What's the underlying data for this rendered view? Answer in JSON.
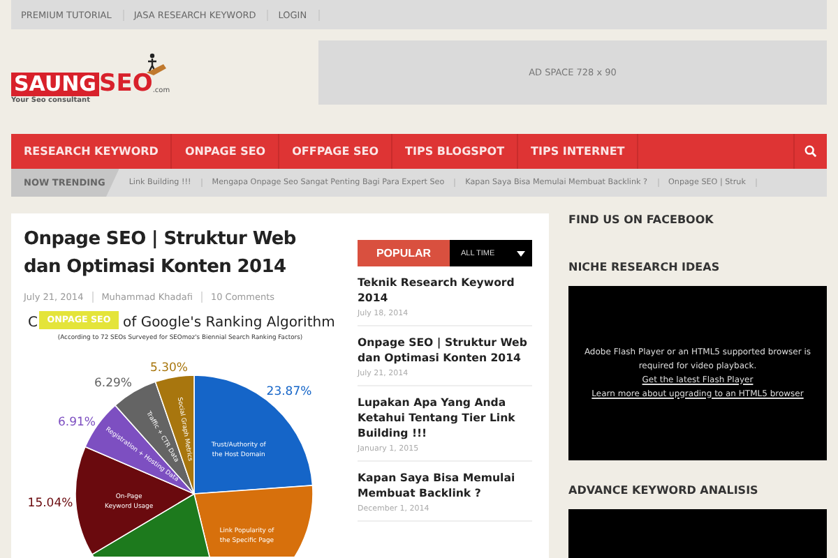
{
  "top_menu": [
    "PREMIUM TUTORIAL",
    "JASA RESEARCH KEYWORD",
    "LOGIN"
  ],
  "logo": {
    "part1": "SAUNG",
    "part2": "SEO",
    "suffix": ".com",
    "tagline": "Your Seo consultant"
  },
  "ad": "AD SPACE 728 x 90",
  "nav": [
    "RESEARCH KEYWORD",
    "ONPAGE SEO",
    "OFFPAGE SEO",
    "TIPS BLOGSPOT",
    "TIPS INTERNET"
  ],
  "trending": {
    "label": "NOW TRENDING",
    "items": [
      "Link Building !!!",
      "Mengapa Onpage Seo Sangat Penting Bagi Para Expert Seo",
      "Kapan Saya Bisa Memulai Membuat Backlink ?",
      "Onpage SEO | Struk"
    ]
  },
  "article": {
    "title": "Onpage SEO | Struktur Web dan Optimasi Konten 2014",
    "meta": [
      "July 21, 2014",
      "Muhammad Khadafi",
      "10 Comments"
    ],
    "badge": "ONPAGE SEO",
    "chart_title_lead": "C",
    "chart_data": {
      "type": "pie",
      "title": "of Google's Ranking Algorithm",
      "subtitle": "(According to 72 SEOs Surveyed for SEOmoz's Biennial Search Ranking Factors)",
      "categories": [
        "Trust/Authority of the Host Domain",
        "Link Popularity of the Specific Page",
        null,
        "On-Page Keyword Usage",
        "Registration + Hosting Data",
        "Traffic + CTR Data",
        "Social Graph Metrics"
      ],
      "values": [
        23.87,
        22.33,
        20.26,
        15.04,
        6.91,
        6.29,
        5.3
      ],
      "colors": [
        "#1565c8",
        "#d7700c",
        "#1d7a1d",
        "#6a0a0e",
        "#7d4fc1",
        "#646464",
        "#a8760e"
      ],
      "value_labels": [
        "23.87%",
        null,
        null,
        "15.04%",
        "6.91%",
        "6.29%",
        "5.30%"
      ]
    }
  },
  "popular": {
    "tab": "POPULAR",
    "filter": "ALL TIME",
    "posts": [
      {
        "title": "Teknik Research Keyword 2014",
        "date": "July 18, 2014"
      },
      {
        "title": "Onpage SEO | Struktur Web dan Optimasi Konten 2014",
        "date": "July 21, 2014"
      },
      {
        "title": "Lupakan Apa Yang Anda Ketahui Tentang Tier Link Building !!!",
        "date": "January 1, 2015"
      },
      {
        "title": "Kapan Saya Bisa Memulai Membuat Backlink ?",
        "date": "December 1, 2014"
      }
    ]
  },
  "sidebar": [
    {
      "title": "FIND US ON FACEBOOK",
      "kind": "empty"
    },
    {
      "title": "NICHE RESEARCH IDEAS",
      "kind": "video",
      "message": "Adobe Flash Player or an HTML5 supported browser is required for video playback.",
      "links": [
        "Get the latest Flash Player",
        "Learn more about upgrading to an HTML5 browser"
      ]
    },
    {
      "title": "ADVANCE KEYWORD ANALISIS",
      "kind": "video"
    }
  ]
}
